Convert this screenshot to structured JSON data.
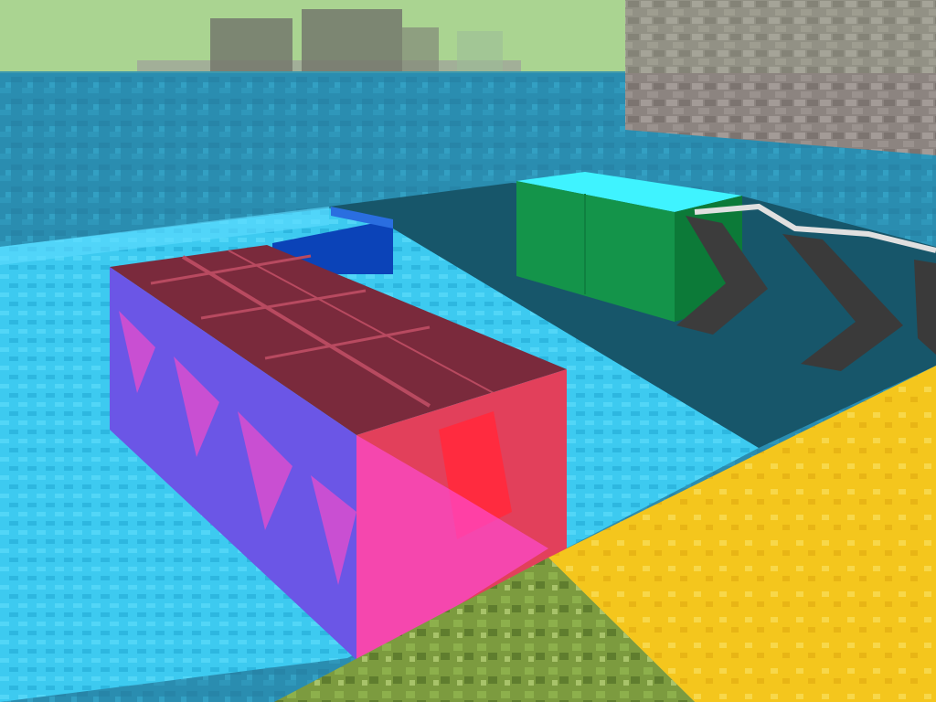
{
  "scene": {
    "type": "voxel-game-first-person-view",
    "colors": {
      "sky": "#a9d38f",
      "water": "#2c8fb0",
      "light_blue_block": "#39c9ee",
      "magenta_glass": "#8a4fd8",
      "red_top": "#7a2a3c",
      "red_face": "#e8384f",
      "green_block": "#159848",
      "cyan_top": "#3ff3ff",
      "yellow_block": "#f1c21b",
      "moss_block": "#7d9a3e",
      "stone_wall": "#8f8782",
      "dark_water": "#17566a"
    },
    "objects": [
      "sky",
      "distant-island",
      "stone-wall",
      "water",
      "light-blue-platform",
      "dark-blue-block",
      "green-block",
      "arrow-chevrons",
      "glazed-terracotta-row",
      "yellow-block",
      "moss-block"
    ]
  }
}
